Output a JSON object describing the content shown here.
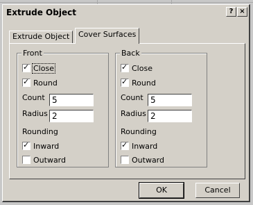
{
  "window": {
    "title": "Extrude Object",
    "help_label": "?",
    "close_label": "×"
  },
  "tabs": [
    {
      "label": "Extrude Object",
      "active": false
    },
    {
      "label": "Cover Surfaces",
      "active": true
    }
  ],
  "front": {
    "title": "Front",
    "close": {
      "label": "Close",
      "checked": true
    },
    "round": {
      "label": "Round",
      "checked": true
    },
    "count": {
      "label": "Count",
      "value": "5"
    },
    "radius": {
      "label": "Radius",
      "value": "2"
    },
    "rounding_label": "Rounding",
    "inward": {
      "label": "Inward",
      "checked": true
    },
    "outward": {
      "label": "Outward",
      "checked": false
    }
  },
  "back": {
    "title": "Back",
    "close": {
      "label": "Close",
      "checked": true
    },
    "round": {
      "label": "Round",
      "checked": true
    },
    "count": {
      "label": "Count",
      "value": "5"
    },
    "radius": {
      "label": "Radius",
      "value": "2"
    },
    "rounding_label": "Rounding",
    "inward": {
      "label": "Inward",
      "checked": true
    },
    "outward": {
      "label": "Outward",
      "checked": false
    }
  },
  "buttons": {
    "ok": "OK",
    "cancel": "Cancel"
  },
  "check_mark": "✓"
}
